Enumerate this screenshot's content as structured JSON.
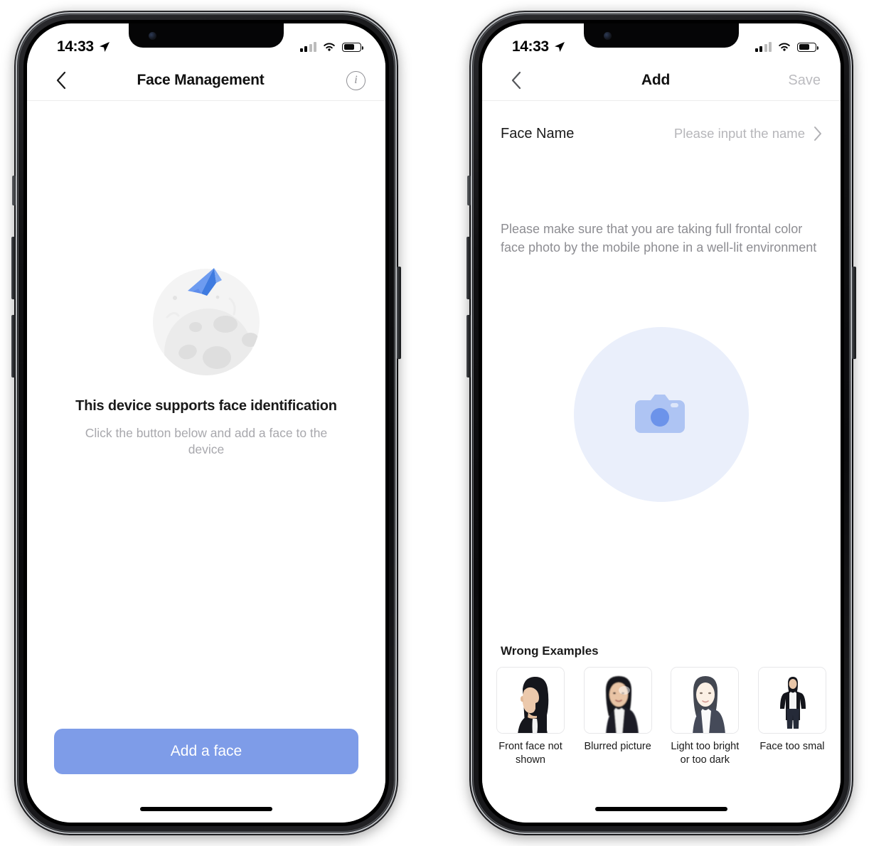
{
  "status_bar": {
    "time": "14:33",
    "location_icon": "location-arrow-icon",
    "signal_icon": "cellular-signal-icon",
    "signal_bars_filled": 2,
    "signal_bars_total": 4,
    "wifi_icon": "wifi-icon",
    "battery_icon": "battery-icon",
    "battery_percent": 62
  },
  "phone_left": {
    "nav": {
      "back_icon": "chevron-left-icon",
      "title": "Face Management",
      "info_icon": "info-circle-icon"
    },
    "illustration": {
      "name": "moon-and-paper-plane-illustration",
      "moon_color": "#f1f1f1",
      "crater_color": "#e2e2e2",
      "plane_color": "#5b8def"
    },
    "empty_state": {
      "title": "This device supports face identification",
      "subtitle": "Click the button below and add a face to the device"
    },
    "primary_button": {
      "label": "Add a face",
      "color": "#7e9ce8",
      "text_color": "#ffffff"
    }
  },
  "phone_right": {
    "nav": {
      "back_icon": "chevron-left-icon",
      "title": "Add",
      "save_label": "Save",
      "save_color": "#bcbcc0"
    },
    "face_name_row": {
      "label": "Face Name",
      "placeholder": "Please input the name",
      "chevron_icon": "chevron-right-icon"
    },
    "description": "Please make sure that you are taking full frontal color face photo by the mobile phone in a well-lit environment",
    "camera_area": {
      "icon": "camera-icon",
      "circle_color": "#eaeffb",
      "icon_color": "#a9c0f2",
      "lens_color": "#6c93ea"
    },
    "wrong_examples": {
      "title": "Wrong Examples",
      "items": [
        {
          "caption": "Front face not shown",
          "thumb": "profile-side-view-photo"
        },
        {
          "caption": "Blurred picture",
          "thumb": "blurred-face-photo"
        },
        {
          "caption": "Light too bright or too dark",
          "thumb": "overexposed-face-photo"
        },
        {
          "caption": "Face too smal",
          "thumb": "full-body-distant-photo"
        }
      ]
    }
  }
}
